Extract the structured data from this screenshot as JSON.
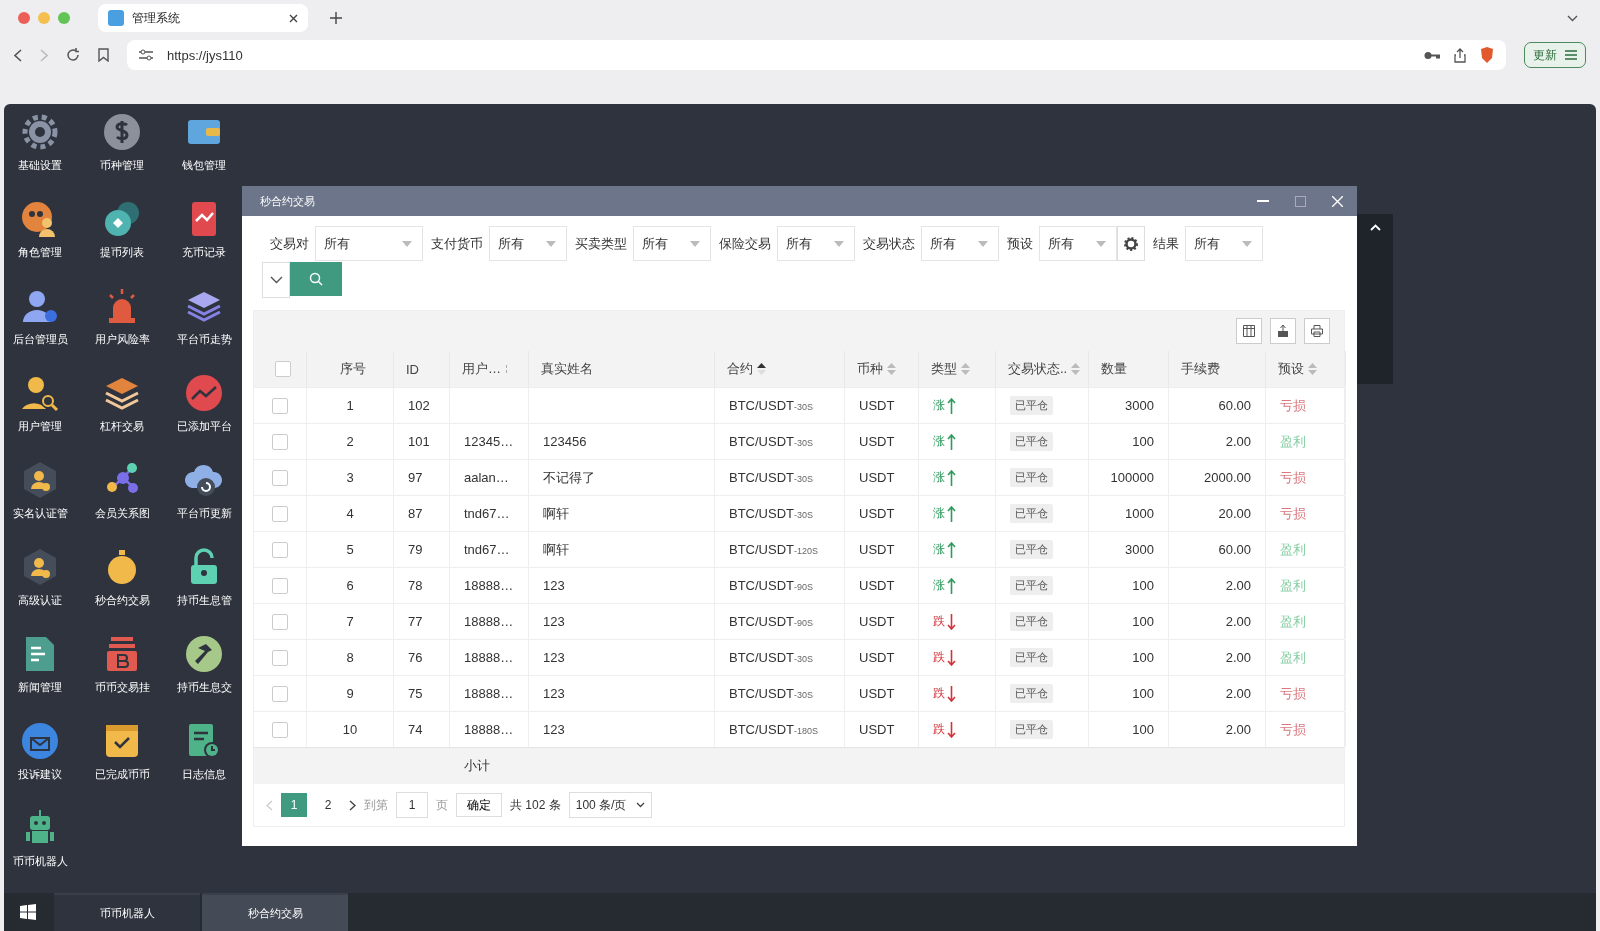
{
  "browser": {
    "tab_title": "管理系统",
    "url": "https://jys110",
    "update_button": "更新"
  },
  "desktop_icons": [
    {
      "label": "基础设置",
      "kind": "gear"
    },
    {
      "label": "币种管理",
      "kind": "dollar"
    },
    {
      "label": "钱包管理",
      "kind": "wallet"
    },
    {
      "label": "角色管理",
      "kind": "users"
    },
    {
      "label": "提币列表",
      "kind": "coins"
    },
    {
      "label": "充币记录",
      "kind": "chartcard"
    },
    {
      "label": "后台管理员",
      "kind": "usergear"
    },
    {
      "label": "用户风险率",
      "kind": "alarm"
    },
    {
      "label": "平台币走势",
      "kind": "layers"
    },
    {
      "label": "用户管理",
      "kind": "usersearch"
    },
    {
      "label": "杠杆交易",
      "kind": "stack"
    },
    {
      "label": "已添加平台",
      "kind": "trend"
    },
    {
      "label": "实名认证管",
      "kind": "userbadge"
    },
    {
      "label": "会员关系图",
      "kind": "network"
    },
    {
      "label": "平台币更新",
      "kind": "cloud"
    },
    {
      "label": "高级认证",
      "kind": "userbadge"
    },
    {
      "label": "秒合约交易",
      "kind": "stopwatch"
    },
    {
      "label": "持币生息管",
      "kind": "padlock"
    },
    {
      "label": "新闻管理",
      "kind": "document"
    },
    {
      "label": "币币交易挂",
      "kind": "bitcoin"
    },
    {
      "label": "持币生息交",
      "kind": "hammer"
    },
    {
      "label": "投诉建议",
      "kind": "mail"
    },
    {
      "label": "已完成币币",
      "kind": "check"
    },
    {
      "label": "日志信息",
      "kind": "log"
    },
    {
      "label": "币币机器人",
      "kind": "robot"
    }
  ],
  "window": {
    "title": "秒合约交易",
    "filters": [
      {
        "label": "交易对",
        "value": "所有"
      },
      {
        "label": "支付货币",
        "value": "所有"
      },
      {
        "label": "买卖类型",
        "value": "所有"
      },
      {
        "label": "保险交易",
        "value": "所有"
      },
      {
        "label": "交易状态",
        "value": "所有"
      },
      {
        "label": "预设",
        "value": "所有",
        "gear": true
      },
      {
        "label": "结果",
        "value": "所有"
      }
    ],
    "table": {
      "select_all_checked": false,
      "columns": [
        {
          "label": "序号",
          "sortable": false
        },
        {
          "label": "ID",
          "sortable": false
        },
        {
          "label": "用户…",
          "sortable": false,
          "resizable": true
        },
        {
          "label": "真实姓名",
          "sortable": false
        },
        {
          "label": "合约",
          "sortable": true,
          "sorted": true
        },
        {
          "label": "币种",
          "sortable": true,
          "sorted": false
        },
        {
          "label": "类型",
          "sortable": true,
          "sorted": false
        },
        {
          "label": "交易状态..",
          "sortable": true,
          "sorted": false
        },
        {
          "label": "数量",
          "sortable": false
        },
        {
          "label": "手续费",
          "sortable": false
        },
        {
          "label": "预设",
          "sortable": true,
          "sorted": false
        }
      ],
      "rows": [
        {
          "checked": false,
          "index": "1",
          "id": "102",
          "contract": "BTC/USDT",
          "period": "-30S",
          "currency": "USDT",
          "direction": "涨",
          "rising": true,
          "status": "已平仓",
          "quantity": "3000",
          "fee": "60.00",
          "preset": "亏损",
          "profit": false
        },
        {
          "checked": false,
          "index": "2",
          "id": "101",
          "user": "12345…",
          "name": "123456",
          "contract": "BTC/USDT",
          "period": "-30S",
          "currency": "USDT",
          "direction": "涨",
          "rising": true,
          "status": "已平仓",
          "quantity": "100",
          "fee": "2.00",
          "preset": "盈利",
          "profit": true
        },
        {
          "checked": false,
          "index": "3",
          "id": "97",
          "user": "aalan…",
          "name": "不记得了",
          "contract": "BTC/USDT",
          "period": "-30S",
          "currency": "USDT",
          "direction": "涨",
          "rising": true,
          "status": "已平仓",
          "quantity": "100000",
          "fee": "2000.00",
          "preset": "亏损",
          "profit": false
        },
        {
          "checked": false,
          "index": "4",
          "id": "87",
          "user": "tnd67…",
          "name": "啊轩",
          "contract": "BTC/USDT",
          "period": "-30S",
          "currency": "USDT",
          "direction": "涨",
          "rising": true,
          "status": "已平仓",
          "quantity": "1000",
          "fee": "20.00",
          "preset": "亏损",
          "profit": false
        },
        {
          "checked": false,
          "index": "5",
          "id": "79",
          "user": "tnd67…",
          "name": "啊轩",
          "contract": "BTC/USDT",
          "period": "-120S",
          "currency": "USDT",
          "direction": "涨",
          "rising": true,
          "status": "已平仓",
          "quantity": "3000",
          "fee": "60.00",
          "preset": "盈利",
          "profit": true
        },
        {
          "checked": false,
          "index": "6",
          "id": "78",
          "user": "18888…",
          "name": "123",
          "contract": "BTC/USDT",
          "period": "-90S",
          "currency": "USDT",
          "direction": "涨",
          "rising": true,
          "status": "已平仓",
          "quantity": "100",
          "fee": "2.00",
          "preset": "盈利",
          "profit": true
        },
        {
          "checked": false,
          "index": "7",
          "id": "77",
          "user": "18888…",
          "name": "123",
          "contract": "BTC/USDT",
          "period": "-90S",
          "currency": "USDT",
          "direction": "跌",
          "rising": false,
          "status": "已平仓",
          "quantity": "100",
          "fee": "2.00",
          "preset": "盈利",
          "profit": true
        },
        {
          "checked": false,
          "index": "8",
          "id": "76",
          "user": "18888…",
          "name": "123",
          "contract": "BTC/USDT",
          "period": "-30S",
          "currency": "USDT",
          "direction": "跌",
          "rising": false,
          "status": "已平仓",
          "quantity": "100",
          "fee": "2.00",
          "preset": "盈利",
          "profit": true
        },
        {
          "checked": false,
          "index": "9",
          "id": "75",
          "user": "18888…",
          "name": "123",
          "contract": "BTC/USDT",
          "period": "-30S",
          "currency": "USDT",
          "direction": "跌",
          "rising": false,
          "status": "已平仓",
          "quantity": "100",
          "fee": "2.00",
          "preset": "亏损",
          "profit": false
        },
        {
          "checked": false,
          "index": "10",
          "id": "74",
          "user": "18888…",
          "name": "123",
          "contract": "BTC/USDT",
          "period": "-180S",
          "currency": "USDT",
          "direction": "跌",
          "rising": false,
          "status": "已平仓",
          "quantity": "100",
          "fee": "2.00",
          "preset": "亏损",
          "profit": false
        }
      ],
      "subtotal_label": "小计"
    },
    "pagination": {
      "pages": [
        {
          "label": "1",
          "selected": true
        },
        {
          "label": "2",
          "selected": false
        }
      ],
      "goto_label": "到第",
      "goto_value": "1",
      "page_unit": "页",
      "confirm": "确定",
      "total": "共 102 条",
      "page_size": "100 条/页"
    }
  },
  "taskbar": {
    "items": [
      {
        "label": "币币机器人",
        "selected": false
      },
      {
        "label": "秒合约交易",
        "selected": true
      }
    ]
  }
}
